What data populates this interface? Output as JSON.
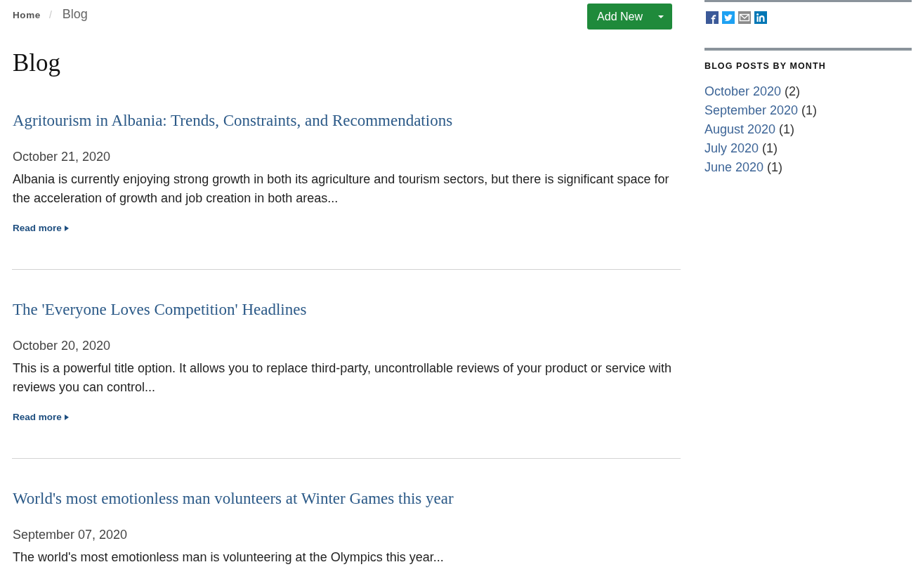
{
  "breadcrumb": {
    "separator": "/",
    "items": [
      {
        "label": "Home",
        "current": false
      },
      {
        "label": "Blog",
        "current": true
      }
    ]
  },
  "add_button": {
    "label": "Add New"
  },
  "page_title": "Blog",
  "posts": [
    {
      "title": "Agritourism in Albania: Trends, Constraints, and Recommendations",
      "date": "October 21, 2020",
      "excerpt": "Albania is currently enjoying strong growth in both its agriculture and tourism sectors, but there is significant space for the acceleration of growth and job creation in both areas...",
      "read_more": "Read more"
    },
    {
      "title": "The 'Everyone Loves Competition' Headlines",
      "date": "October 20, 2020",
      "excerpt": "This is a powerful title option. It allows you to replace third-party, uncontrollable reviews of your product or service with reviews you can control...",
      "read_more": "Read more"
    },
    {
      "title": "World's most emotionless man volunteers at Winter Games this year",
      "date": "September 07, 2020",
      "excerpt": "The world's most emotionless man is volunteering at the Olympics this year..."
    }
  ],
  "sidebar": {
    "archive": {
      "heading": "BLOG POSTS BY MONTH",
      "months": [
        {
          "label": "October 2020",
          "count": "(2)"
        },
        {
          "label": "September 2020",
          "count": "(1)"
        },
        {
          "label": "August 2020",
          "count": "(1)"
        },
        {
          "label": "July 2020",
          "count": "(1)"
        },
        {
          "label": "June 2020",
          "count": "(1)"
        }
      ]
    }
  }
}
